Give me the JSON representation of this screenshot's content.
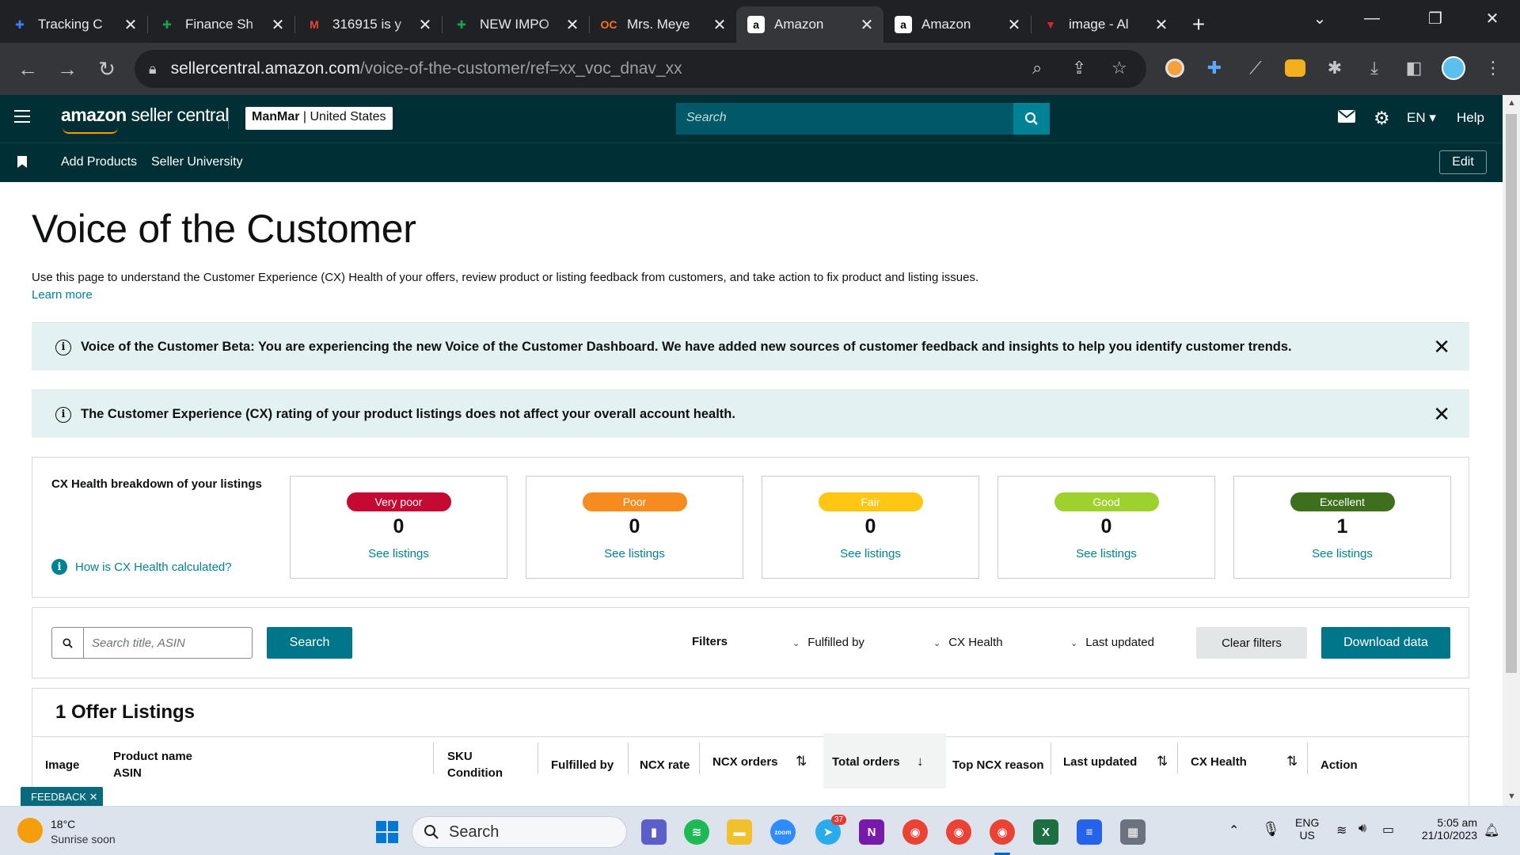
{
  "browser": {
    "tabs": [
      {
        "title": "Tracking C",
        "icon": "plus-blue-icon",
        "color": "#3b82f6",
        "glyph": "✚"
      },
      {
        "title": "Finance Sh",
        "icon": "sheets-plus-icon",
        "color": "#16a34a",
        "glyph": "✚"
      },
      {
        "title": "316915 is y",
        "icon": "gmail-icon",
        "color": "#ea4335",
        "glyph": "M"
      },
      {
        "title": "NEW IMPO",
        "icon": "sheets-plus-icon",
        "color": "#16a34a",
        "glyph": "✚"
      },
      {
        "title": "Mrs. Meye",
        "icon": "oc-icon",
        "color": "#f97316",
        "glyph": "OC"
      },
      {
        "title": "Amazon",
        "icon": "amazon-a-icon",
        "color": "#ffffff",
        "glyph": "a",
        "active": true
      },
      {
        "title": "Amazon",
        "icon": "amazon-a-icon",
        "color": "#ffffff",
        "glyph": "a"
      },
      {
        "title": "image - Al",
        "icon": "image-logo-icon",
        "color": "#dc2626",
        "glyph": "▼"
      }
    ],
    "url_host": "sellercentral.amazon.com",
    "url_path": "/voice-of-the-customer/ref=xx_voc_dnav_xx"
  },
  "header": {
    "logo_bold": "amazon",
    "logo_rest": " seller central",
    "store_name": "ManMar",
    "store_region": " | United States",
    "search_placeholder": "Search",
    "lang": "EN ▾",
    "help": "Help"
  },
  "nav": {
    "links": [
      "Add Products",
      "Seller University"
    ],
    "edit": "Edit"
  },
  "page": {
    "title": "Voice of the Customer",
    "intro": "Use this page to understand the Customer Experience (CX) Health of your offers, review product or listing feedback from customers, and take action to fix product and listing issues.",
    "learn_more": "Learn more",
    "alert_beta": "Voice of the Customer Beta: You are experiencing the new Voice of the Customer Dashboard. We have added new sources of customer feedback and insights to help you identify customer trends.",
    "alert_cx": "The Customer Experience (CX) rating of your product listings does not affect your overall account health."
  },
  "cx": {
    "label": "CX Health breakdown of your listings",
    "how": "How is CX Health calculated?",
    "tiles": [
      {
        "label": "Very poor",
        "count": "0",
        "link": "See listings",
        "color": "#c40a33"
      },
      {
        "label": "Poor",
        "count": "0",
        "link": "See listings",
        "color": "#f68b1f"
      },
      {
        "label": "Fair",
        "count": "0",
        "link": "See listings",
        "color": "#ffc613"
      },
      {
        "label": "Good",
        "count": "0",
        "link": "See listings",
        "color": "#9fd12e"
      },
      {
        "label": "Excellent",
        "count": "1",
        "link": "See listings",
        "color": "#3d6f1c"
      }
    ]
  },
  "filters": {
    "search_placeholder": "Search title, ASIN",
    "search_btn": "Search",
    "label": "Filters",
    "dropdowns": [
      "Fulfilled by",
      "CX Health",
      "Last updated"
    ],
    "clear": "Clear filters",
    "download": "Download data"
  },
  "listings": {
    "title": "1 Offer Listings",
    "columns": {
      "image": "Image",
      "product": "Product name",
      "asin": "ASIN",
      "sku": "SKU",
      "condition": "Condition",
      "fulfilled": "Fulfilled by",
      "ncx_rate": "NCX rate",
      "ncx_orders": "NCX orders",
      "total_orders": "Total orders",
      "top_reason": "Top NCX reason",
      "last_updated": "Last updated",
      "cx_health": "CX Health",
      "action": "Action"
    }
  },
  "feedback": "FEEDBACK ✕",
  "taskbar": {
    "temp": "18°C",
    "weather": "Sunrise soon",
    "search": "Search",
    "lang1": "ENG",
    "lang2": "US",
    "time": "5:05 am",
    "date": "21/10/2023",
    "telegram_badge": "37"
  }
}
